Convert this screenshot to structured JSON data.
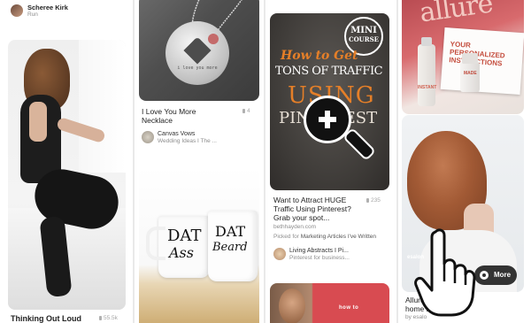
{
  "pins": [
    {
      "pinner_name": "Scheree Kirk",
      "board": "Run",
      "title": "Thinking Out Loud",
      "repins": "55.5k"
    },
    {
      "title_line1": "I Love You More",
      "title_line2": "Necklace",
      "repins": "4",
      "source_name": "Canvas Vows",
      "source_board": "Wedding Ideas I The ...",
      "image_text": "i love you more",
      "mug_left_top": "DAT",
      "mug_left_bottom": "Ass",
      "mug_right_top": "DAT",
      "mug_right_bottom": "Beard"
    },
    {
      "image_badge_line1": "MINI",
      "image_badge_line2": "COURSE",
      "image_line1": "How to Get",
      "image_line2": "TONS OF TRAFFIC",
      "image_line3": "USING",
      "image_line4": "PINTEREST",
      "title_line1": "Want to Attract HUGE",
      "title_line2": "Traffic Using Pinterest?",
      "title_line3": "Grab your spot...",
      "repins": "235",
      "domain": "bethhayden.com",
      "picked_prefix": "Picked for",
      "picked_board": "Marketing Articles I've Written",
      "source_name": "Living Abstracts I Pi...",
      "source_board": "Pinterest for business...",
      "next_image_text": "how to"
    },
    {
      "image_brand": "allure",
      "image_text": "YOUR PERSONALIZED INSTRUCTIONS",
      "image_small": "MADE",
      "image_small2": "INSTANT",
      "overlay_tag": "esalon",
      "more_button": "More",
      "title_line1": "Allure's",
      "title_line2": "home ha",
      "title_line3": "by esalo"
    }
  ]
}
